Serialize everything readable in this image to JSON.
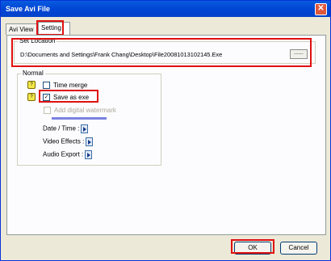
{
  "window": {
    "title": "Save Avi File",
    "close_glyph": "✕"
  },
  "tabs": [
    {
      "label": "Avi View"
    },
    {
      "label": "Setting"
    }
  ],
  "set_location": {
    "legend": "Set Location",
    "path": "D:\\Documents and Settings\\Frank Chang\\Desktop\\File20081013102145.Exe",
    "browse_label": "......"
  },
  "normal": {
    "legend": "Normal",
    "time_merge": {
      "label": "Time merge",
      "checked": false
    },
    "save_as_exe": {
      "label": "Save as exe",
      "checked": true
    },
    "digital_watermark": {
      "label": "Add digital watermark",
      "enabled": false
    },
    "date_time_label": "Date / Time :",
    "video_effects_label": "Video Effects :",
    "audio_export_label": "Audio Export :",
    "help_glyph": "?",
    "check_glyph": "✓"
  },
  "buttons": {
    "ok": "OK",
    "cancel": "Cancel"
  },
  "colors": {
    "titlebar": "#0046d5",
    "highlight": "#e01010",
    "watermark_bar": "#7b82e0"
  }
}
